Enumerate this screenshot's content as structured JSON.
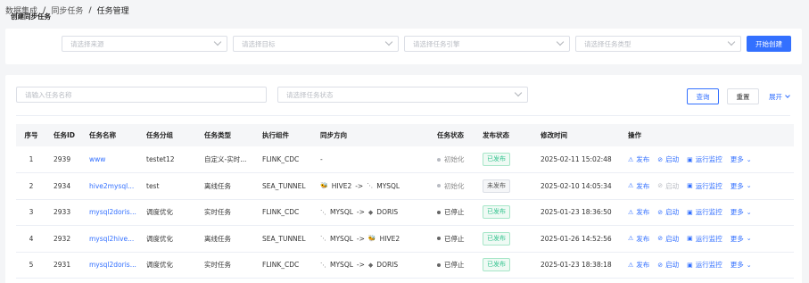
{
  "breadcrumb": [
    "数据集成",
    "同步任务",
    "任务管理"
  ],
  "create": {
    "label": "创建同步任务",
    "source_placeholder": "请选择来源",
    "target_placeholder": "请选择目标",
    "engine_placeholder": "请选择任务引擎",
    "type_placeholder": "请选择任务类型",
    "create_button": "开始创建"
  },
  "filter": {
    "name_placeholder": "请输入任务名称",
    "status_placeholder": "请选择任务状态",
    "query_button": "查询",
    "reset_button": "重置",
    "expand_label": "展开"
  },
  "table": {
    "headers": {
      "idx": "序号",
      "id": "任务ID",
      "name": "任务名称",
      "group": "任务分组",
      "type": "任务类型",
      "engine": "执行组件",
      "direction": "同步方向",
      "task_status": "任务状态",
      "publish_status": "发布状态",
      "modified": "修改时间",
      "ops": "操作"
    },
    "rows": [
      {
        "idx": "1",
        "id": "2939",
        "name": "www",
        "group": "testet12",
        "type": "自定义-实时...",
        "engine": "FLINK_CDC",
        "source": "",
        "source_icon": "",
        "dash": "-",
        "target": "",
        "target_icon": "",
        "task_status": "初始化",
        "publish_status": "已发布",
        "modified": "2025-02-11 15:02:48",
        "start_disabled": false
      },
      {
        "idx": "2",
        "id": "2934",
        "name": "hive2mysql...",
        "group": "test",
        "type": "离线任务",
        "engine": "SEA_TUNNEL",
        "source": "HIVE2",
        "source_icon": "hive-icon",
        "dash": "",
        "target": "MYSQL",
        "target_icon": "mysql-icon",
        "task_status": "初始化",
        "publish_status": "未发布",
        "modified": "2025-02-10 14:05:34",
        "start_disabled": true
      },
      {
        "idx": "3",
        "id": "2933",
        "name": "mysql2doris...",
        "group": "调度优化",
        "type": "实时任务",
        "engine": "FLINK_CDC",
        "source": "MYSQL",
        "source_icon": "mysql-icon",
        "dash": "",
        "target": "DORIS",
        "target_icon": "doris-icon",
        "task_status": "已停止",
        "publish_status": "已发布",
        "modified": "2025-01-23 18:36:50",
        "start_disabled": false
      },
      {
        "idx": "4",
        "id": "2932",
        "name": "mysql2hive...",
        "group": "调度优化",
        "type": "离线任务",
        "engine": "SEA_TUNNEL",
        "source": "MYSQL",
        "source_icon": "mysql-icon",
        "dash": "",
        "target": "HIVE2",
        "target_icon": "hive-icon",
        "task_status": "已停止",
        "publish_status": "已发布",
        "modified": "2025-01-26 14:52:56",
        "start_disabled": false
      },
      {
        "idx": "5",
        "id": "2931",
        "name": "mysql2doris...",
        "group": "调度优化",
        "type": "实时任务",
        "engine": "FLINK_CDC",
        "source": "MYSQL",
        "source_icon": "mysql-icon",
        "dash": "",
        "target": "DORIS",
        "target_icon": "doris-icon",
        "task_status": "已停止",
        "publish_status": "已发布",
        "modified": "2025-01-23 18:38:18",
        "start_disabled": false
      }
    ],
    "op_labels": {
      "publish": "发布",
      "start": "启动",
      "monitor": "运行监控",
      "more": "更多"
    }
  },
  "colors": {
    "accent": "#3370ff",
    "published": "#34c38f",
    "background": "#f4f5f7"
  }
}
